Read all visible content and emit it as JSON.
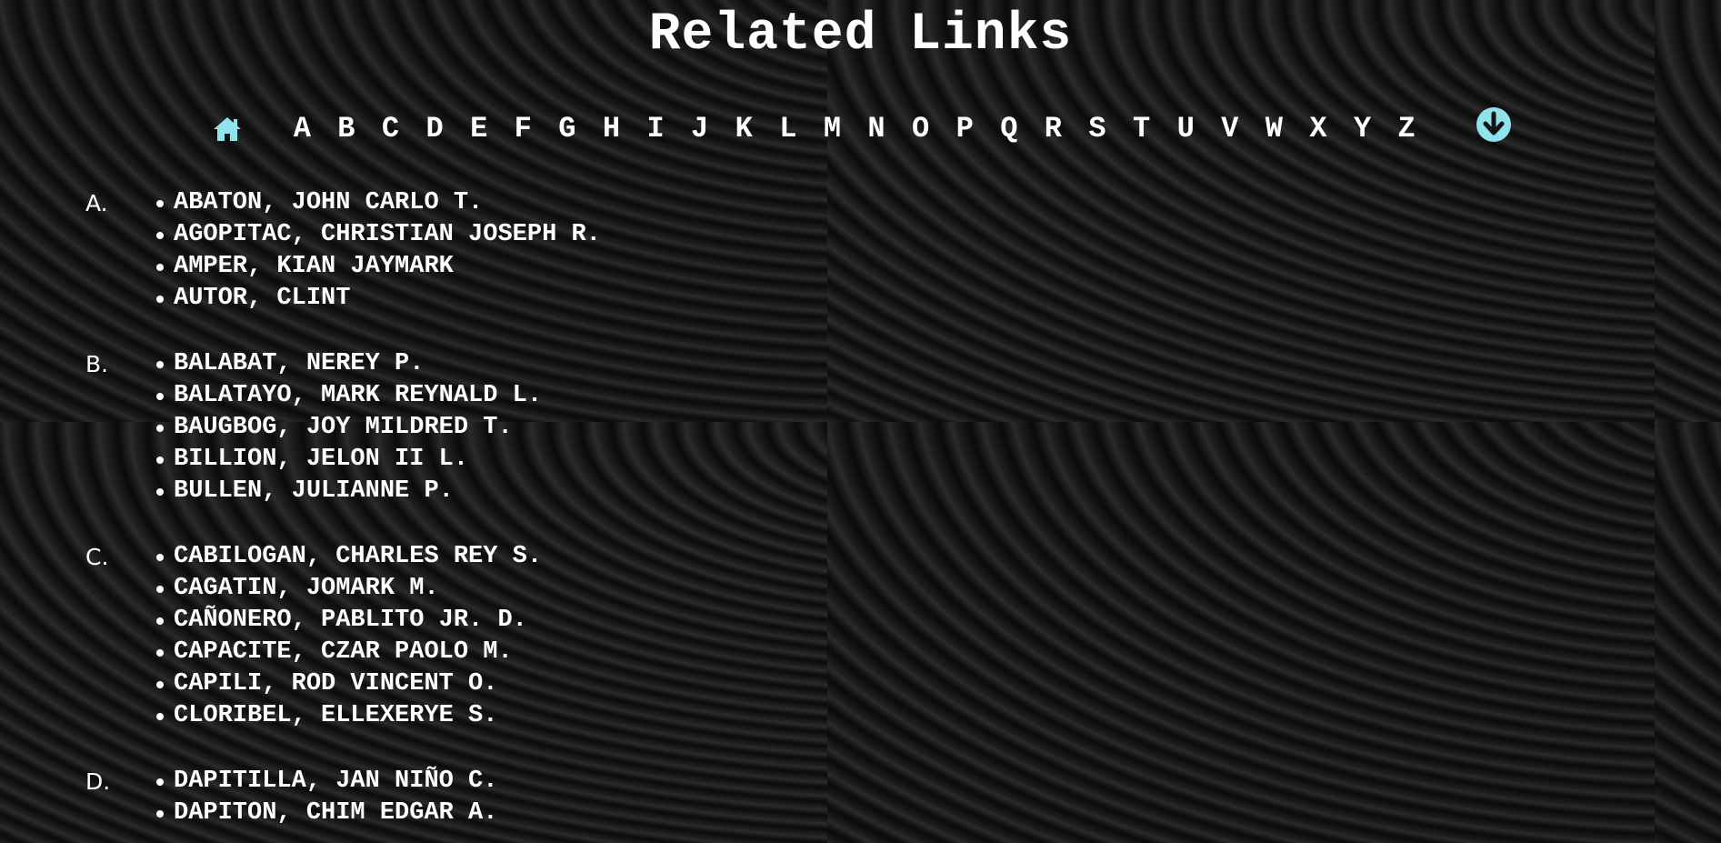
{
  "page": {
    "title": "Related Links",
    "accent_color": "#8fe3ea"
  },
  "nav": {
    "home_icon": "home-icon",
    "down_icon": "arrow-down-circle-icon",
    "letters": [
      "A",
      "B",
      "C",
      "D",
      "E",
      "F",
      "G",
      "H",
      "I",
      "J",
      "K",
      "L",
      "M",
      "N",
      "O",
      "P",
      "Q",
      "R",
      "S",
      "T",
      "U",
      "V",
      "W",
      "X",
      "Y",
      "Z"
    ]
  },
  "sections": [
    {
      "label": "A.",
      "names": [
        "ABATON, JOHN CARLO T.",
        "AGOPITAC, CHRISTIAN JOSEPH R.",
        "AMPER, KIAN JAYMARK",
        "AUTOR, CLINT"
      ]
    },
    {
      "label": "B.",
      "names": [
        "BALABAT, NEREY P.",
        "BALATAYO, MARK REYNALD L.",
        "BAUGBOG, JOY MILDRED T.",
        "BILLION, JELON II L.",
        "BULLEN, JULIANNE P."
      ]
    },
    {
      "label": "C.",
      "names": [
        "CABILOGAN, CHARLES REY S.",
        "CAGATIN, JOMARK M.",
        "CAÑONERO, PABLITO JR. D.",
        "CAPACITE, CZAR PAOLO M.",
        "CAPILI, ROD VINCENT O.",
        "CLORIBEL, ELLEXERYE S."
      ]
    },
    {
      "label": "D.",
      "names": [
        "DAPITILLA, JAN NIÑO C.",
        "DAPITON, CHIM EDGAR A."
      ]
    }
  ]
}
